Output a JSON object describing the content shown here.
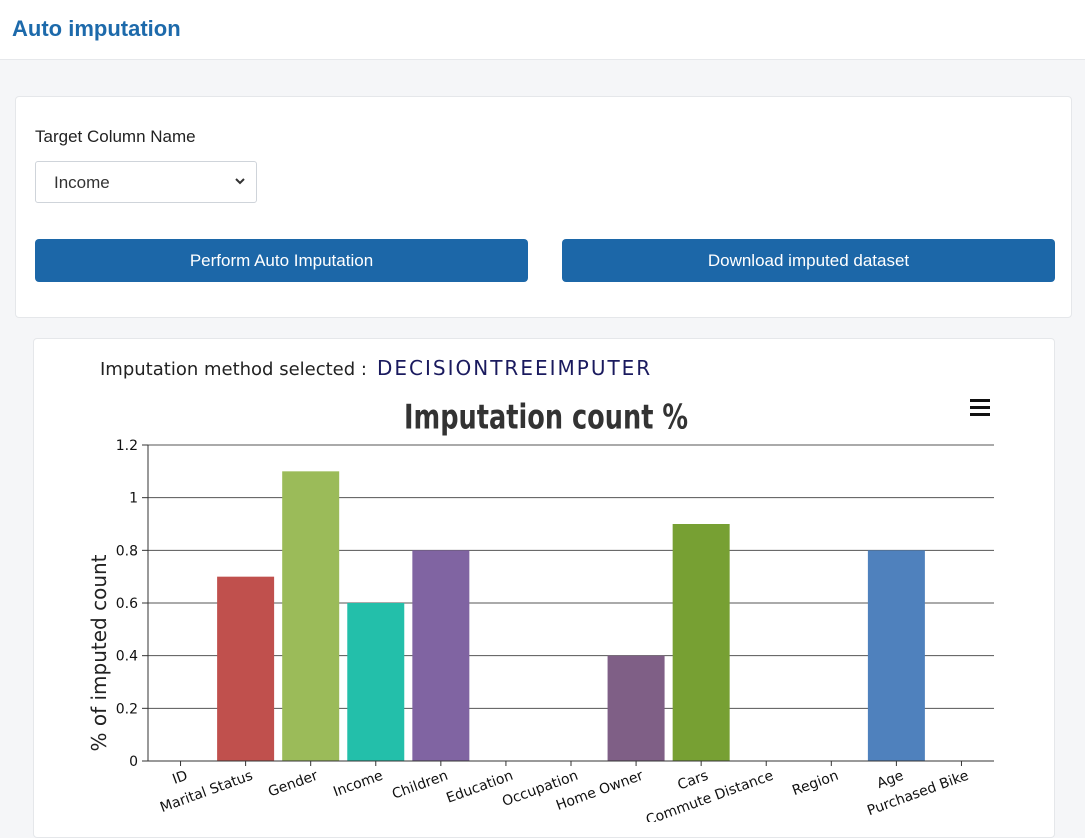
{
  "header": {
    "title": "Auto imputation"
  },
  "form": {
    "target_label": "Target Column Name",
    "target_value": "Income",
    "perform_button": "Perform Auto Imputation",
    "download_button": "Download imputed dataset"
  },
  "method": {
    "label": "Imputation method selected :",
    "value": "DECISIONTREEIMPUTER"
  },
  "icons": {
    "select": "chevron-down-icon",
    "chart_menu": "hamburger-menu-icon"
  },
  "chart_data": {
    "type": "bar",
    "title": "Imputation count %",
    "xlabel": "",
    "ylabel": "% of imputed count",
    "ylim": [
      0,
      1.2
    ],
    "yticks": [
      "0",
      "0.2",
      "0.4",
      "0.6",
      "0.8",
      "1",
      "1.2"
    ],
    "grid": true,
    "categories": [
      "ID",
      "Marital Status",
      "Gender",
      "Income",
      "Children",
      "Education",
      "Occupation",
      "Home Owner",
      "Cars",
      "Commute Distance",
      "Region",
      "Age",
      "Purchased Bike"
    ],
    "values": [
      0,
      0.7,
      1.1,
      0.6,
      0.8,
      0,
      0,
      0.4,
      0.9,
      0,
      0,
      0.8,
      0
    ],
    "colors": [
      "#4f81bd",
      "#c0504d",
      "#9bbb59",
      "#23bfaa",
      "#8064a2",
      "#4bacc6",
      "#f79646",
      "#7f5f86",
      "#77a033",
      "#4aacc5",
      "#f59d56",
      "#4f81bd",
      "#c0504d"
    ]
  }
}
